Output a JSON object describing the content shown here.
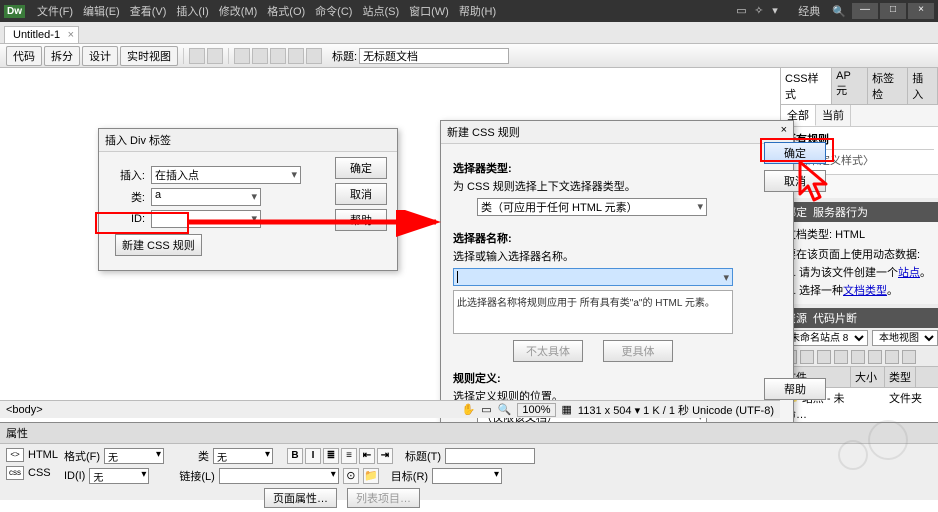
{
  "top": {
    "logo": "Dw",
    "menus": [
      "文件(F)",
      "编辑(E)",
      "查看(V)",
      "插入(I)",
      "修改(M)",
      "格式(O)",
      "命令(C)",
      "站点(S)",
      "窗口(W)",
      "帮助(H)"
    ],
    "mode": "经典",
    "win": {
      "min": "—",
      "max": "□",
      "close": "×"
    }
  },
  "doc": {
    "tab": "Untitled-1",
    "x": "×"
  },
  "toolbar": {
    "btns": [
      "代码",
      "拆分",
      "设计",
      "实时视图"
    ],
    "title_label": "标题:",
    "title_value": "无标题文档"
  },
  "divDlg": {
    "title": "插入 Div 标签",
    "insert_label": "插入:",
    "insert_value": "在插入点",
    "class_label": "类:",
    "class_value": "a",
    "id_label": "ID:",
    "id_value": "",
    "ok": "确定",
    "cancel": "取消",
    "help": "帮助",
    "newcss": "新建 CSS 规则"
  },
  "cssDlg": {
    "title": "新建 CSS 规则",
    "close": "×",
    "selType_h": "选择器类型:",
    "selType_sub": "为 CSS 规则选择上下文选择器类型。",
    "selType_val": "类（可应用于任何 HTML 元素）",
    "selName_h": "选择器名称:",
    "selName_sub": "选择或输入选择器名称。",
    "selName_val": "",
    "desc": "此选择器名称将规则应用于\n所有具有类\"a\"的 HTML 元素。",
    "less": "不太具体",
    "more": "更具体",
    "ruleDef_h": "规则定义:",
    "ruleDef_sub": "选择定义规则的位置。",
    "ruleDef_val": "（仅限该文档）",
    "ok": "确定",
    "cancel": "取消",
    "help": "帮助"
  },
  "css_panel": {
    "tabs": [
      "CSS样式",
      "AP 元",
      "标签检",
      "插入"
    ],
    "sub": [
      "全部",
      "当前"
    ],
    "all_rules": "所有规则",
    "style_item": "〈未定义样式〉"
  },
  "bind_panel": {
    "tabs": [
      "绑定",
      "服务器行为"
    ],
    "doc_type_label": "文档类型:",
    "doc_type": "HTML",
    "prompt": "要在该页面上使用动态数据:",
    "steps": [
      "请为该文件创建一个",
      "选择一种"
    ],
    "step_links": [
      "站点",
      "文档类型"
    ],
    "period": "。"
  },
  "assets_panel": {
    "tabs": [
      "资源",
      "代码片断"
    ],
    "site_sel": "未命名站点 8",
    "view_sel": "本地视图",
    "cols": [
      "文件",
      "大小",
      "类型"
    ],
    "row_file": "站点 - 未命…",
    "row_type": "文件夹"
  },
  "status": {
    "body": "<body>",
    "zoom": "100%",
    "dims": "1131 x 504 ▾ 1 K / 1 秒 Unicode (UTF-8)"
  },
  "props": {
    "title": "属性",
    "html_opt": "HTML",
    "css_opt": "CSS",
    "format_label": "格式(F)",
    "format_val": "无",
    "id_label": "ID(I)",
    "id_val": "无",
    "class_label": "类",
    "class_val": "无",
    "link_label": "链接(L)",
    "link_val": "",
    "b": "B",
    "i": "I",
    "title_label": "标题(T)",
    "target_label": "目标(R)",
    "page_attr": "页面属性…",
    "list_item": "列表项目…"
  }
}
